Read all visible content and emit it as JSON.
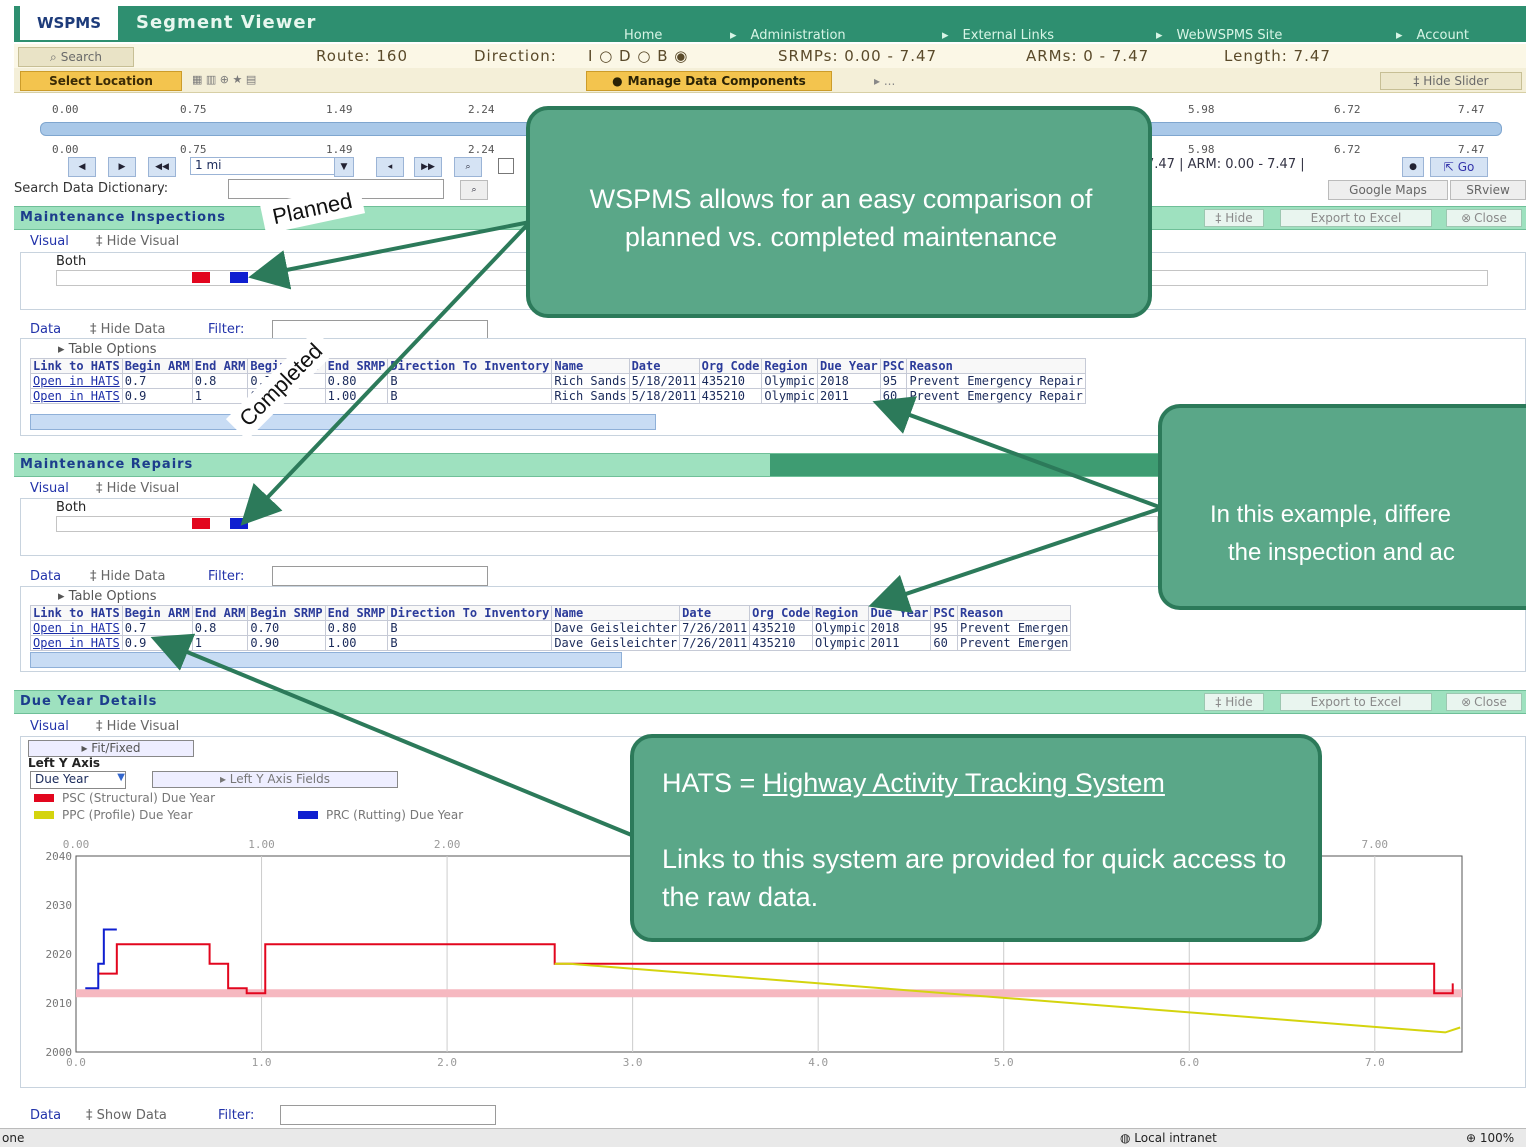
{
  "header": {
    "logo": "WSPMS",
    "app_title": "Segment Viewer",
    "nav": [
      "Home",
      "Administration",
      "External Links",
      "WebWSPMS Site",
      "Account"
    ]
  },
  "route_bar": {
    "search": "Search",
    "route": "Route: 160",
    "direction_label": "Direction:",
    "direction_options": "I ○ D ○ B ◉",
    "srmps": "SRMPs: 0.00 - 7.47",
    "arms": "ARMs: 0 - 7.47",
    "length": "Length: 7.47"
  },
  "select_row": {
    "select_location": "Select Location",
    "manage_data": "Manage Data Components",
    "more": "▸ ...",
    "hide_slider": "‡ Hide Slider"
  },
  "slider": {
    "top_ticks": [
      "0.00",
      "0.75",
      "1.49",
      "2.24",
      "5.98",
      "6.72",
      "7.47"
    ],
    "bottom_ticks": [
      "0.00",
      "0.75",
      "1.49",
      "2.24",
      "5.98",
      "6.72",
      "7.47"
    ],
    "unit": "1 mi",
    "arm_info": "7.47  |  ARM: 0.00 - 7.47  |",
    "go": "Go"
  },
  "dictionary": {
    "label": "Search Data Dictionary:",
    "google_maps": "Google Maps",
    "srview": "SRview"
  },
  "inspections": {
    "title": "Maintenance Inspections",
    "hide": "‡ Hide",
    "export": "Export to Excel",
    "close": "Close",
    "visual": "Visual",
    "hide_visual": "‡ Hide Visual",
    "both": "Both",
    "data": "Data",
    "hide_data": "‡ Hide Data",
    "filter": "Filter:",
    "table_options": "▸ Table Options",
    "columns": [
      "Link to HATS",
      "Begin ARM",
      "End ARM",
      "Begin SRMP",
      "End SRMP",
      "Direction To Inventory",
      "Name",
      "Date",
      "Org Code",
      "Region",
      "Due Year",
      "PSC",
      "Reason"
    ],
    "rows": [
      [
        "Open in HATS",
        "0.7",
        "0.8",
        "0.70",
        "0.80",
        "B",
        "Rich Sands",
        "5/18/2011",
        "435210",
        "Olympic",
        "2018",
        "95",
        "Prevent Emergency Repair"
      ],
      [
        "Open in HATS",
        "0.9",
        "1",
        "0.90",
        "1.00",
        "B",
        "Rich Sands",
        "5/18/2011",
        "435210",
        "Olympic",
        "2011",
        "60",
        "Prevent Emergency Repair"
      ]
    ]
  },
  "repairs": {
    "title": "Maintenance Repairs",
    "visual": "Visual",
    "hide_visual": "‡ Hide Visual",
    "both": "Both",
    "data": "Data",
    "hide_data": "‡ Hide Data",
    "filter": "Filter:",
    "table_options": "▸ Table Options",
    "columns": [
      "Link to HATS",
      "Begin ARM",
      "End ARM",
      "Begin SRMP",
      "End SRMP",
      "Direction To Inventory",
      "Name",
      "Date",
      "Org Code",
      "Region",
      "Due Year",
      "PSC",
      "Reason"
    ],
    "rows": [
      [
        "Open in HATS",
        "0.7",
        "0.8",
        "0.70",
        "0.80",
        "B",
        "Dave Geisleichter",
        "7/26/2011",
        "435210",
        "Olympic",
        "2018",
        "95",
        "Prevent Emergen"
      ],
      [
        "Open in HATS",
        "0.9",
        "1",
        "0.90",
        "1.00",
        "B",
        "Dave Geisleichter",
        "7/26/2011",
        "435210",
        "Olympic",
        "2011",
        "60",
        "Prevent Emergen"
      ]
    ]
  },
  "due_year": {
    "title": "Due Year Details",
    "hide": "‡ Hide",
    "export": "Export to Excel",
    "close": "Close",
    "visual": "Visual",
    "hide_visual": "‡ Hide Visual",
    "fit_fixed": "▸ Fit/Fixed",
    "left_y_axis": "Left Y Axis",
    "due_year_select": "Due Year",
    "left_y_fields": "▸ Left Y Axis Fields",
    "data": "Data",
    "show_data": "‡ Show Data",
    "filter": "Filter:",
    "legend": [
      "PSC (Structural) Due Year",
      "PPC (Profile) Due Year",
      "PRC (Rutting) Due Year"
    ]
  },
  "chart_data": {
    "type": "line",
    "title": "",
    "xlabel": "",
    "ylabel": "",
    "xlim": [
      0,
      7.47
    ],
    "ylim": [
      2000,
      2040
    ],
    "x_ticks": [
      "0.0",
      "1.0",
      "2.0",
      "3.0",
      "4.0",
      "5.0",
      "6.0",
      "7.0"
    ],
    "top_ticks": [
      "0.00",
      "1.00",
      "2.00",
      "7.00"
    ],
    "y_ticks": [
      "2040",
      "2030",
      "2020",
      "2010",
      "2000"
    ],
    "series": [
      {
        "name": "PSC (Structural) Due Year",
        "color": "#e2061e",
        "x": [
          0.12,
          0.22,
          0.22,
          0.72,
          0.72,
          0.82,
          0.82,
          0.92,
          0.92,
          1.02,
          1.02,
          2.58,
          2.58,
          7.32,
          7.32,
          7.42,
          7.42
        ],
        "y": [
          2016,
          2016,
          2022,
          2022,
          2018,
          2018,
          2013,
          2013,
          2012,
          2012,
          2022,
          2022,
          2018,
          2018,
          2012,
          2012,
          2014
        ]
      },
      {
        "name": "PPC (Profile) Due Year",
        "color": "#d4d40e",
        "x": [
          2.58,
          2.66,
          7.38,
          7.46
        ],
        "y": [
          2018,
          2018,
          2004,
          2005
        ]
      },
      {
        "name": "PRC (Rutting) Due Year",
        "color": "#0f1fd0",
        "x": [
          0.05,
          0.12,
          0.12,
          0.15,
          0.15,
          0.22
        ],
        "y": [
          2013,
          2013,
          2018,
          2018,
          2025,
          2025
        ]
      }
    ],
    "bands": [
      {
        "y": 2012,
        "color": "#f6b8c0"
      }
    ],
    "grid": "vertical"
  },
  "callouts": {
    "compare": "WSPMS allows for an easy comparison of planned vs. completed maintenance",
    "example_line1": "In this example, differe",
    "example_line2": "the inspection and ac",
    "hats_prefix": "HATS = ",
    "hats_name": "Highway Activity Tracking System",
    "hats_links": "Links to this system are provided for quick access to the raw data.",
    "planned": "Planned",
    "completed": "Completed"
  },
  "status": {
    "left": "one",
    "zone": "Local intranet",
    "zoom": "100%"
  }
}
